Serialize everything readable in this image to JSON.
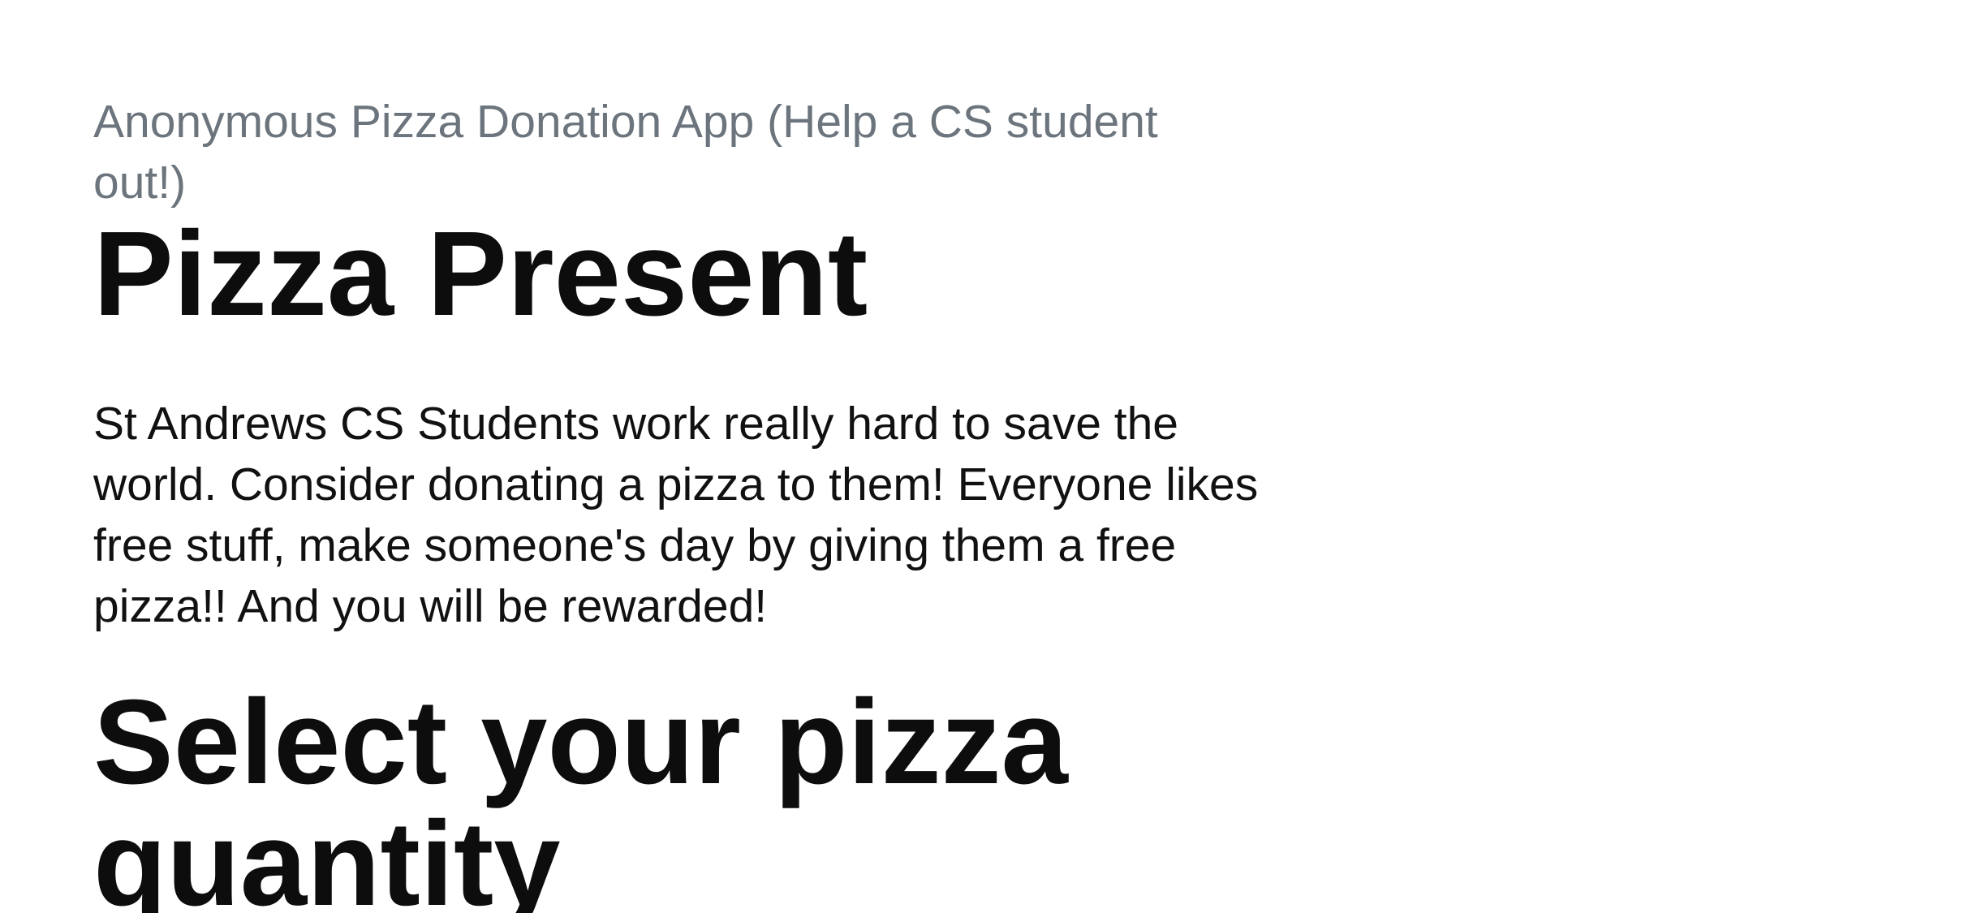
{
  "header": {
    "eyebrow": "Anonymous Pizza Donation App (Help a CS student out!)",
    "title": "Pizza Present"
  },
  "intro": {
    "description": "St Andrews CS Students work really hard to save the world. Consider donating a pizza to them! Everyone likes free stuff, make someone's day by giving them a free pizza!! And you will be rewarded!"
  },
  "quantity_section": {
    "heading": "Select your pizza quantity"
  },
  "colors": {
    "eyebrow_text": "#6c757d",
    "heading_text": "#0d0d0d",
    "body_text": "#111111",
    "background": "#ffffff"
  }
}
